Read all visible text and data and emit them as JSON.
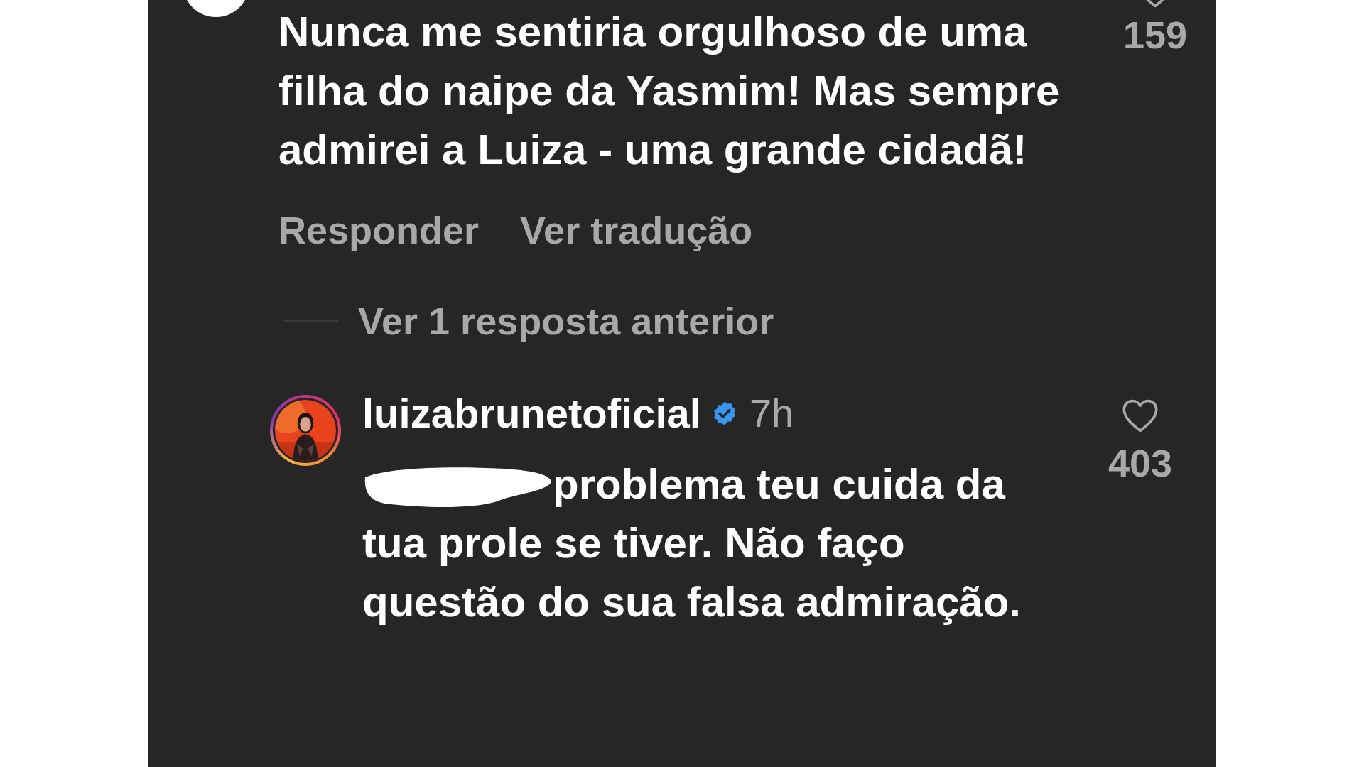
{
  "comment": {
    "text": "Nunca me sentiria orgulhoso de uma filha do naipe da Yasmim! Mas sempre admirei a Luiza - uma grande cidadã!",
    "liked": false,
    "likes": "159",
    "actions": [
      "Responder",
      "Ver tradução"
    ]
  },
  "replies_toggle": "Ver 1 resposta anterior",
  "reply": {
    "username": "luizabrunetoficial",
    "verified": true,
    "time": "7h",
    "mention_redacted": true,
    "text": "problema teu cuida da tua prole se tiver. Não faço questão do sua falsa admiração.",
    "liked": false,
    "likes": "403"
  }
}
